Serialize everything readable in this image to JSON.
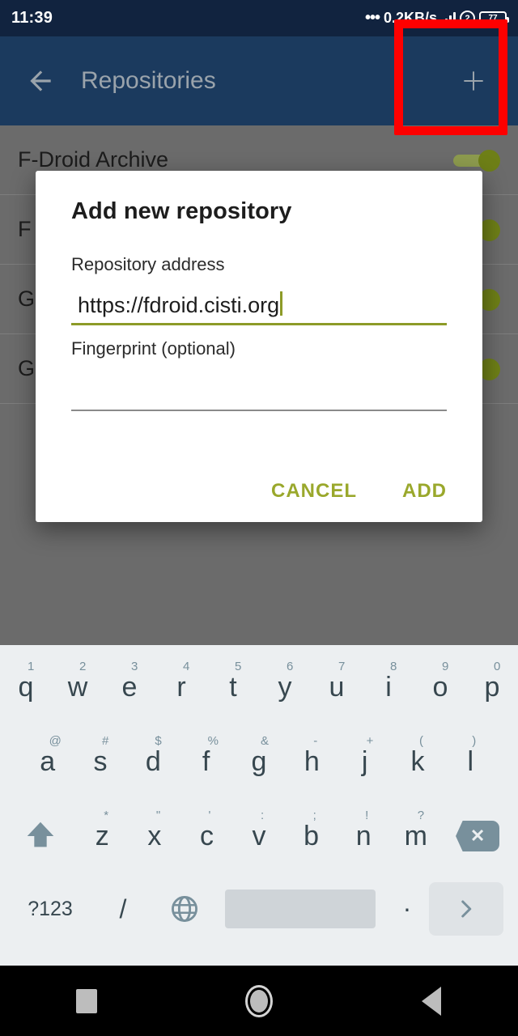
{
  "status_bar": {
    "clock": "11:39",
    "dots": "•••",
    "data_rate": "0.2KB/s",
    "sim_label": "2",
    "battery_label": "77"
  },
  "app_bar": {
    "title": "Repositories",
    "back_icon": "arrow-left-icon",
    "add_icon": "plus-icon"
  },
  "repo_list": {
    "rows": [
      {
        "name": "F-Droid Archive",
        "enabled": true
      },
      {
        "name": "F",
        "enabled": true
      },
      {
        "name": "G",
        "enabled": true
      },
      {
        "name": "G",
        "enabled": true
      }
    ]
  },
  "dialog": {
    "title": "Add new repository",
    "address_label": "Repository address",
    "address_value": "https://fdroid.cisti.org",
    "address_placeholder": "",
    "fingerprint_label": "Fingerprint (optional)",
    "fingerprint_value": "",
    "fingerprint_placeholder": "",
    "cancel_label": "CANCEL",
    "add_label": "ADD",
    "accent_color": "#9aa82c"
  },
  "annotation": {
    "color": "#fe0000",
    "target": "add-repository-button"
  },
  "keyboard": {
    "row1": [
      {
        "key": "q",
        "hint": "1"
      },
      {
        "key": "w",
        "hint": "2"
      },
      {
        "key": "e",
        "hint": "3"
      },
      {
        "key": "r",
        "hint": "4"
      },
      {
        "key": "t",
        "hint": "5"
      },
      {
        "key": "y",
        "hint": "6"
      },
      {
        "key": "u",
        "hint": "7"
      },
      {
        "key": "i",
        "hint": "8"
      },
      {
        "key": "o",
        "hint": "9"
      },
      {
        "key": "p",
        "hint": "0"
      }
    ],
    "row2": [
      {
        "key": "a",
        "hint": "@"
      },
      {
        "key": "s",
        "hint": "#"
      },
      {
        "key": "d",
        "hint": "$"
      },
      {
        "key": "f",
        "hint": "%"
      },
      {
        "key": "g",
        "hint": "&"
      },
      {
        "key": "h",
        "hint": "-"
      },
      {
        "key": "j",
        "hint": "+"
      },
      {
        "key": "k",
        "hint": "("
      },
      {
        "key": "l",
        "hint": ")"
      }
    ],
    "row3": [
      {
        "key": "z",
        "hint": "*"
      },
      {
        "key": "x",
        "hint": "\""
      },
      {
        "key": "c",
        "hint": "'"
      },
      {
        "key": "v",
        "hint": ":"
      },
      {
        "key": "b",
        "hint": ";"
      },
      {
        "key": "n",
        "hint": "!"
      },
      {
        "key": "m",
        "hint": "?"
      }
    ],
    "shift_icon": "shift-up-arrow-icon",
    "delete_icon": "backspace-icon",
    "delete_glyph": "✕",
    "symbols_label": "?123",
    "slash_label": "/",
    "globe_icon": "globe-language-icon",
    "space_label": "",
    "period_label": ".",
    "enter_icon": "chevron-right-enter-icon"
  },
  "nav_bar": {
    "recents_icon": "square-recents-icon",
    "home_icon": "circle-home-icon",
    "back_icon": "triangle-back-icon"
  }
}
